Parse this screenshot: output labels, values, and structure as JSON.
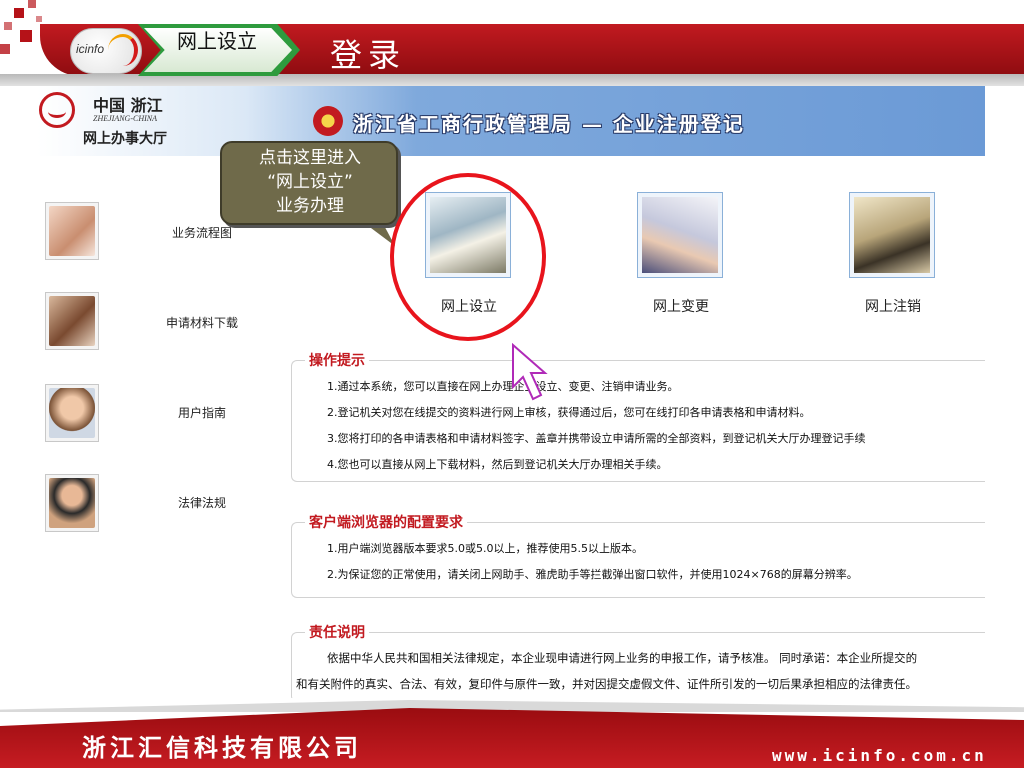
{
  "slide": {
    "logo_text": "icinfo",
    "tag_label": "网上设立",
    "title": "登录",
    "company": "浙江汇信科技有限公司",
    "url": "www.icinfo.com.cn"
  },
  "web": {
    "brand_name": "中国 浙江",
    "brand_en": "ZHEJIANG-CHINA",
    "brand_hall": "网上办事大厅",
    "header_title": "浙江省工商行政管理局 — 企业注册登记",
    "sidebar": [
      {
        "label": "业务流程图"
      },
      {
        "label": "申请材料下载"
      },
      {
        "label": "用户指南"
      },
      {
        "label": "法律法规"
      }
    ],
    "services": [
      {
        "label": "网上设立"
      },
      {
        "label": "网上变更"
      },
      {
        "label": "网上注销"
      }
    ],
    "tips": {
      "title": "操作提示",
      "lines": [
        "1.通过本系统，您可以直接在网上办理企业设立、变更、注销申请业务。",
        "2.登记机关对您在线提交的资料进行网上审核，获得通过后，您可在线打印各申请表格和申请材料。",
        "3.您将打印的各申请表格和申请材料签字、盖章并携带设立申请所需的全部资料，到登记机关大厅办理登记手续",
        "4.您也可以直接从网上下载材料，然后到登记机关大厅办理相关手续。"
      ]
    },
    "browser": {
      "title": "客户端浏览器的配置要求",
      "lines": [
        "1.用户端浏览器版本要求5.0或5.0以上，推荐使用5.5以上版本。",
        "2.为保证您的正常使用，请关闭上网助手、雅虎助手等拦截弹出窗口软件，并使用1024×768的屏幕分辨率。"
      ]
    },
    "responsibility": {
      "title": "责任说明",
      "line1": "依据中华人民共和国相关法律规定，本企业现申请进行网上业务的申报工作，请予核准。 同时承诺：本企业所提交的",
      "line2": "和有关附件的真实、合法、有效，复印件与原件一致，并对因提交虚假文件、证件所引发的一切后果承担相应的法律责任。"
    }
  },
  "callout": {
    "line1": "点击这里进入",
    "line2": "“网上设立”",
    "line3": "业务办理"
  },
  "colors": {
    "brand_red": "#c21a20",
    "header_blue": "#6b9ad6",
    "callout_olive": "#6f6a4a",
    "highlight_ring": "#e8141c"
  }
}
